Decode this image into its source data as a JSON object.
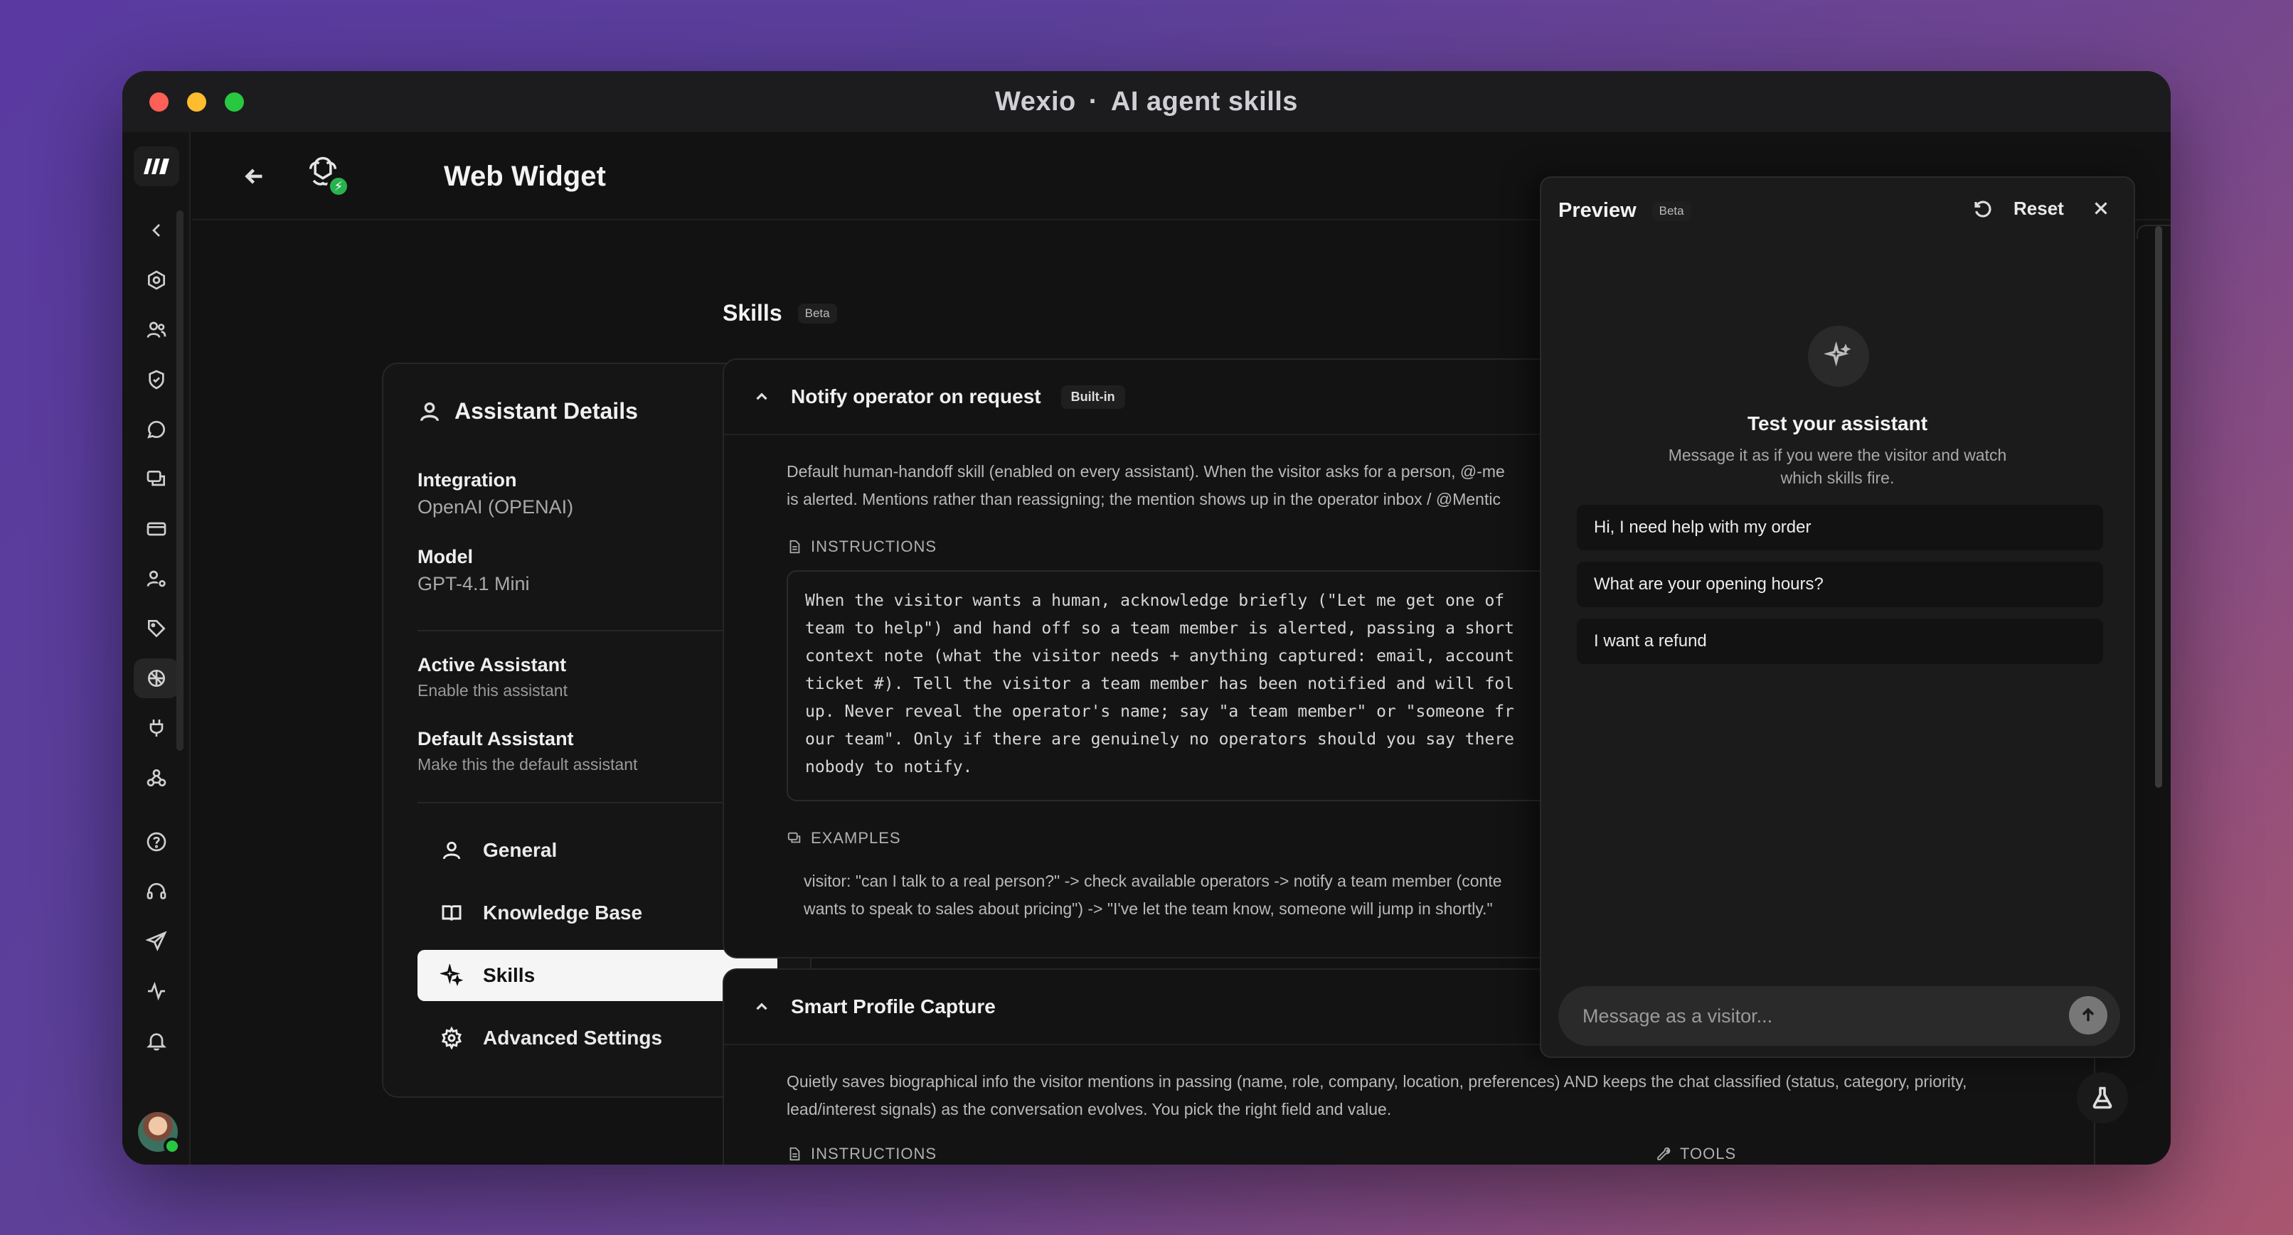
{
  "window": {
    "app_name": "Wexio",
    "separator": "·",
    "section": "AI agent skills"
  },
  "header": {
    "title": "Web Widget"
  },
  "details": {
    "heading": "Assistant Details",
    "integration_label": "Integration",
    "integration_value": "OpenAI (OPENAI)",
    "model_label": "Model",
    "model_value": "GPT-4.1 Mini",
    "active_label": "Active Assistant",
    "active_sub": "Enable this assistant",
    "active_on": true,
    "default_label": "Default Assistant",
    "default_sub": "Make this the default assistant",
    "default_on": false,
    "nav": [
      {
        "label": "General",
        "icon": "user-icon"
      },
      {
        "label": "Knowledge Base",
        "icon": "book-icon"
      },
      {
        "label": "Skills",
        "icon": "sparkles-icon",
        "active": true
      },
      {
        "label": "Advanced Settings",
        "icon": "gear-icon"
      }
    ]
  },
  "skills": {
    "title": "Skills",
    "beta": "Beta",
    "items": [
      {
        "name": "Notify operator on request",
        "badge": "Built-in",
        "desc_line1": "Default human-handoff skill (enabled on every assistant). When the visitor asks for a person, @-me",
        "desc_line2": "is alerted. Mentions rather than reassigning; the mention shows up in the operator inbox / @Mentic",
        "instructions_label": "INSTRUCTIONS",
        "instructions": [
          "When the visitor wants a human, acknowledge briefly (\"Let me get one of",
          "team to help\") and hand off so a team member is alerted, passing a short",
          "context note (what the visitor needs + anything captured: email, account",
          "ticket #). Tell the visitor a team member has been notified and will fol",
          "up. Never reveal the operator's name; say \"a team member\" or \"someone fr",
          "our team\". Only if there are genuinely no operators should you say there",
          "nobody to notify."
        ],
        "examples_label": "EXAMPLES",
        "examples_line1": "visitor: \"can I talk to a real person?\" -> check available operators -> notify a team member (conte",
        "examples_line2": "wants to speak to sales about pricing\") -> \"I've let the team know, someone will jump in shortly.\""
      },
      {
        "name": "Smart Profile Capture",
        "desc_line1": "Quietly saves biographical info the visitor mentions in passing (name, role, company, location, preferences) AND keeps the chat classified (status, category, priority,",
        "desc_line2": "lead/interest signals) as the conversation evolves. You pick the right field and value.",
        "instructions_label": "INSTRUCTIONS",
        "tools_label": "TOOLS"
      }
    ]
  },
  "preview": {
    "title": "Preview",
    "beta": "Beta",
    "reset_label": "Reset",
    "test_title": "Test your assistant",
    "test_sub": "Message it as if you were the visitor and watch which skills fire.",
    "suggestions": [
      "Hi, I need help with my order",
      "What are your opening hours?",
      "I want a refund"
    ],
    "composer_placeholder": "Message as a visitor..."
  }
}
